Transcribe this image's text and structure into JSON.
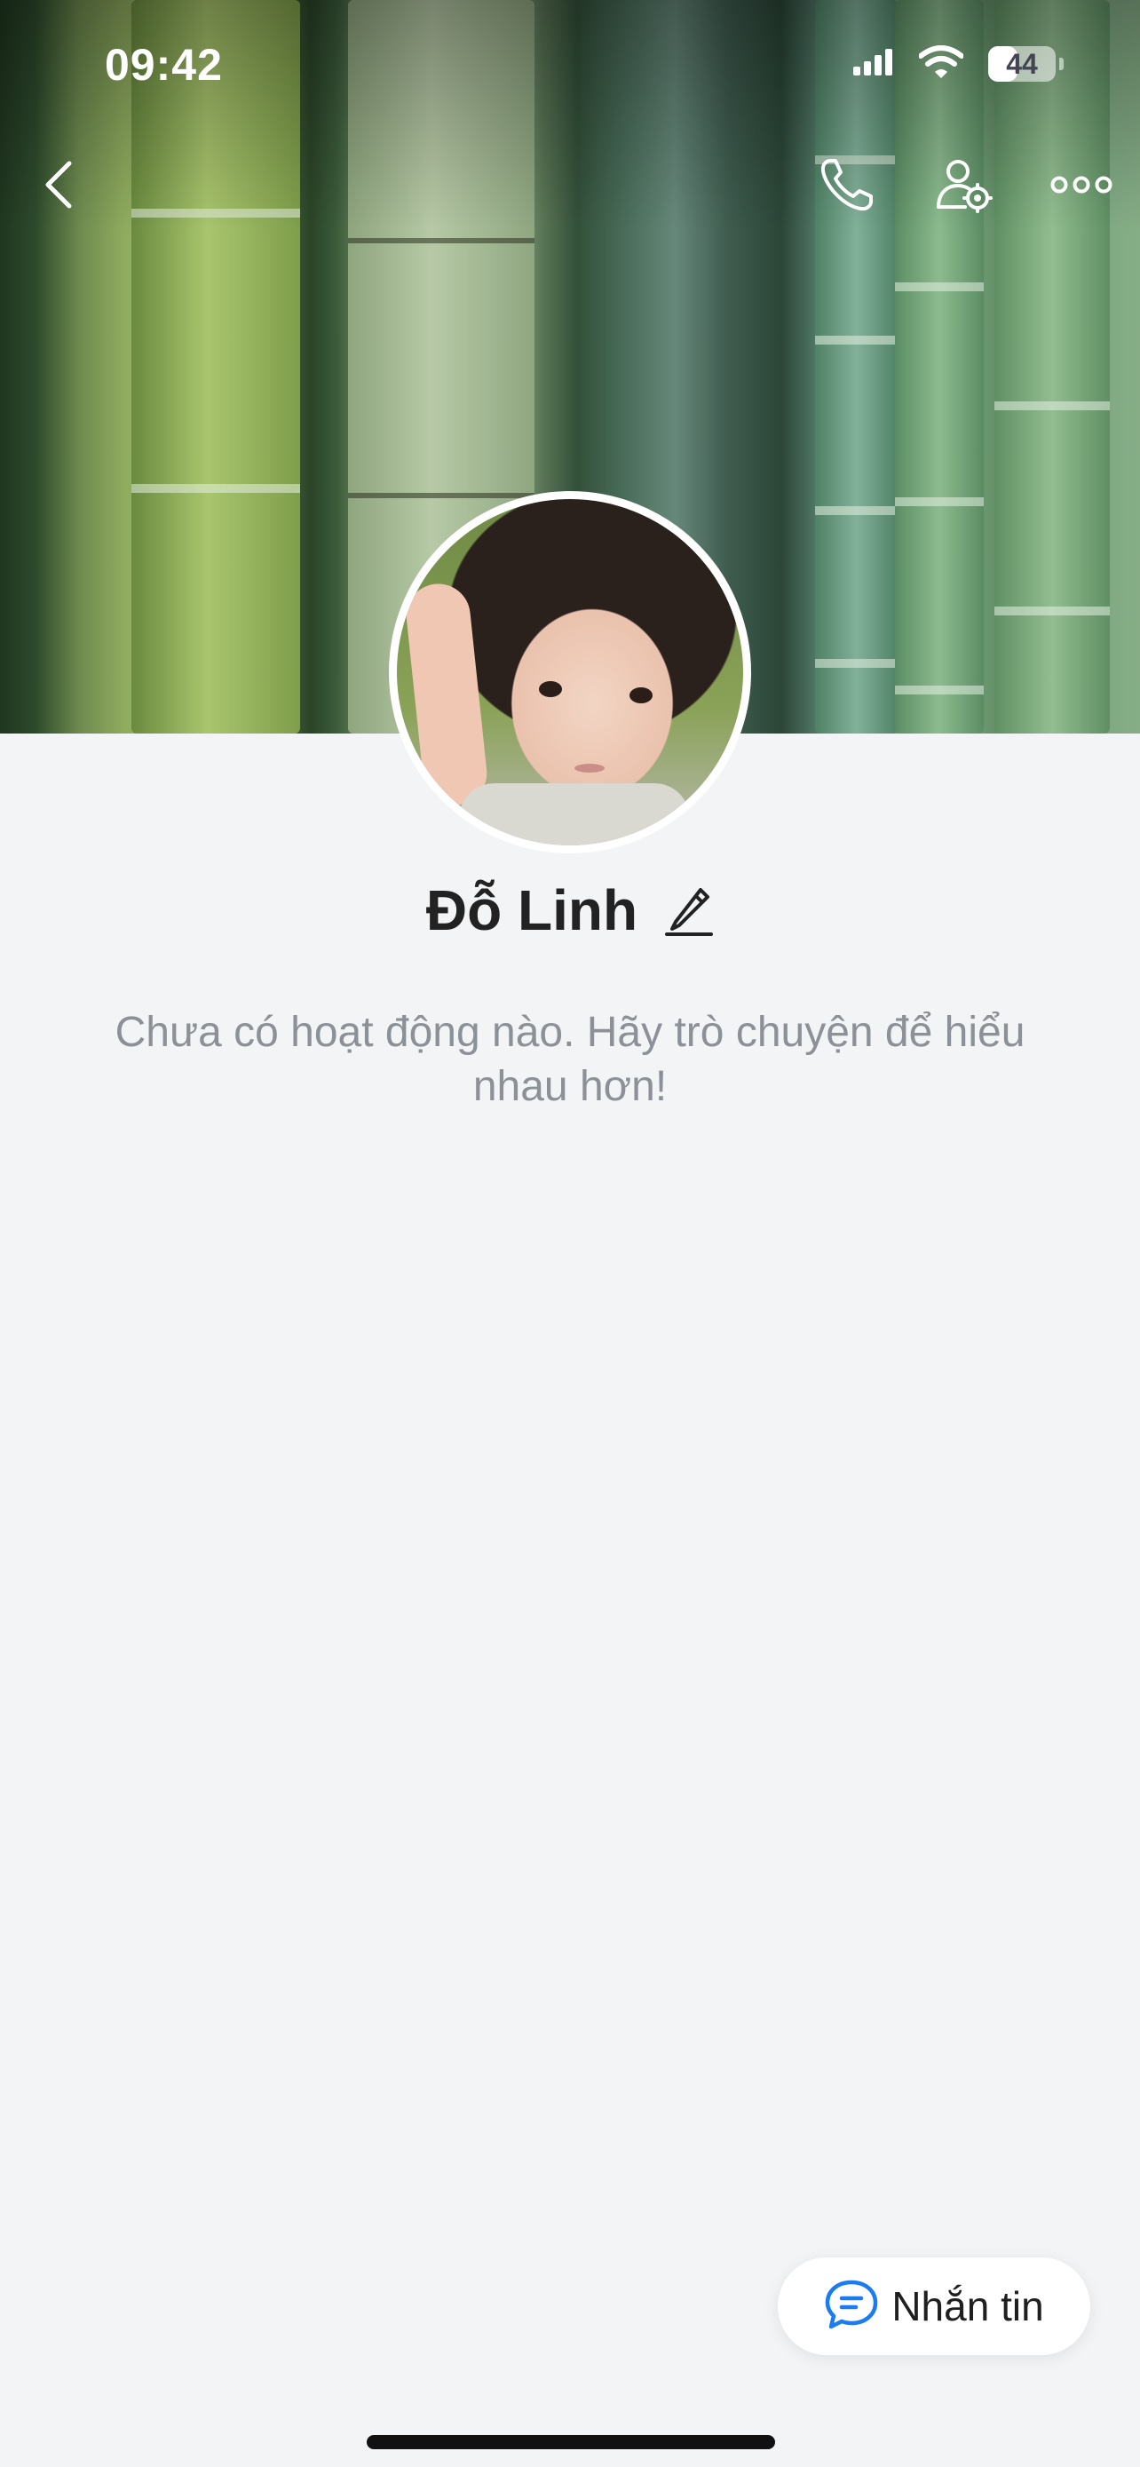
{
  "status_bar": {
    "time": "09:42",
    "battery_percent": "44",
    "battery_level": 0.44,
    "icons": [
      "cellular-signal-icon",
      "wifi-icon",
      "battery-icon"
    ]
  },
  "nav": {
    "icons": [
      "back-chevron-icon",
      "phone-icon",
      "profile-settings-icon",
      "more-dots-icon"
    ]
  },
  "profile": {
    "name": "Đỗ Linh",
    "edit_icon": "pencil-icon",
    "empty_activity": "Chưa có hoạt động nào. Hãy trò chuyện để hiểu nhau hơn!"
  },
  "actions": {
    "message_label": "Nhắn tin",
    "message_icon": "chat-bubble-icon"
  },
  "colors": {
    "background": "#f3f4f6",
    "accent": "#1a7cf0",
    "muted_text": "#8c9198"
  }
}
